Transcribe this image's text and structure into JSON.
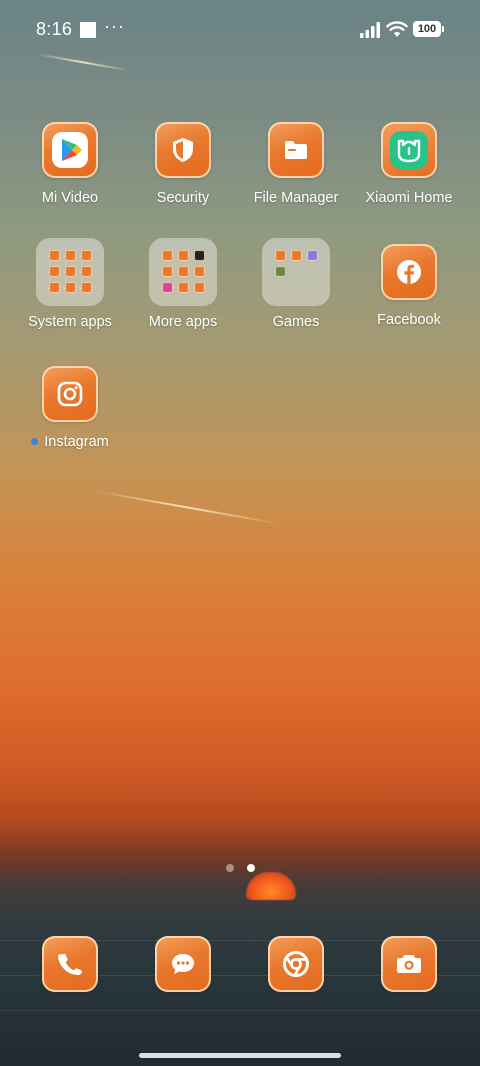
{
  "status_bar": {
    "time": "8:16",
    "overflow": "···",
    "battery": "100",
    "icons": [
      "notification-square-icon",
      "signal-icon",
      "wifi-icon",
      "battery-icon"
    ]
  },
  "apps": {
    "mi_video": "Mi Video",
    "security": "Security",
    "file_manager": "File Manager",
    "xiaomi_home": "Xiaomi Home",
    "system_apps": "System apps",
    "more_apps": "More apps",
    "games": "Games",
    "facebook": "Facebook",
    "instagram": "Instagram"
  },
  "dock": {
    "items": [
      "phone-icon",
      "messages-icon",
      "chrome-icon",
      "camera-icon"
    ]
  },
  "pages": {
    "count": 2,
    "active_index": 1
  },
  "colors": {
    "icon_orange": "#e8782d",
    "new_app_dot": "#3d7cf0"
  }
}
